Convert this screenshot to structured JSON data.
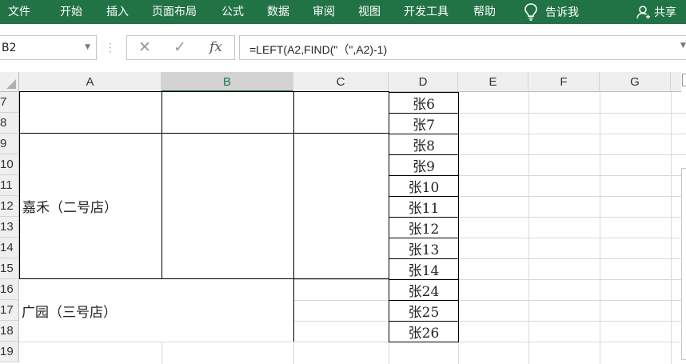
{
  "ribbon": {
    "tabs": [
      "文件",
      "开始",
      "插入",
      "页面布局",
      "公式",
      "数据",
      "审阅",
      "视图",
      "开发工具",
      "帮助"
    ],
    "tell_me": "告诉我",
    "share": "共享",
    "bg_color": "#217346"
  },
  "formula_bar": {
    "name_box": "B2",
    "formula": "=LEFT(A2,FIND(\"（\",A2)-1)",
    "cancel_icon": "✕",
    "enter_icon": "✓",
    "fx": "fx"
  },
  "columns": [
    "A",
    "B",
    "C",
    "D",
    "E",
    "F",
    "G"
  ],
  "rows": [
    "7",
    "8",
    "9",
    "10",
    "11",
    "12",
    "13",
    "14",
    "15",
    "16",
    "17",
    "18",
    "19"
  ],
  "cells": {
    "a_store2": "嘉禾（二号店）",
    "a_store3": "广园（三号店）",
    "d_values": [
      "张6",
      "张7",
      "张8",
      "张9",
      "张10",
      "张11",
      "张12",
      "张13",
      "张14",
      "张24",
      "张25",
      "张26"
    ]
  }
}
